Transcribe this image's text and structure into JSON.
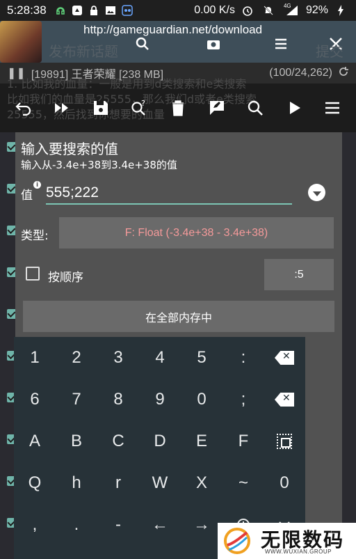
{
  "status_bar": {
    "time": "5:28:38",
    "network_speed": "0.00 K/s",
    "signal_label": "4G",
    "battery": "92%"
  },
  "browser": {
    "url": "http://gameguardian.net/download"
  },
  "background": {
    "title": "发布新话题",
    "submit": "提交",
    "process": "[19891] 王者荣耀 [238 MB]",
    "result_count": "(100/24,262)",
    "note_lines": [
      "1. 比如我的血量：一般是用到d类搜索和e类搜索",
      "比如我们的血量是25555，那么我们d或者e类搜索",
      "25555，然后找到你想要的血量"
    ]
  },
  "dialog": {
    "title": "输入要搜索的值",
    "subtitle": "输入从-3.4e+38到3.4e+38的值",
    "value_label": "值",
    "value": "555;222",
    "type_label": "类型:",
    "type_value": "F: Float (-3.4e+38 - 3.4e+38)",
    "order_label": "按顺序",
    "step_value": ":5",
    "region_label": "在全部内存中"
  },
  "keyboard": {
    "rows": [
      [
        "1",
        "2",
        "3",
        "4",
        "5",
        ":"
      ],
      [
        "6",
        "7",
        "8",
        "9",
        "0",
        ";"
      ],
      [
        "A",
        "B",
        "C",
        "D",
        "E",
        "F"
      ],
      [
        "Q",
        "h",
        "r",
        "W",
        "X",
        "~",
        "0"
      ],
      [
        ",",
        ".",
        "-",
        "←",
        "→"
      ]
    ]
  },
  "watermark": {
    "title": "无限数码",
    "url": "WWW.WUXIAN.GROUP"
  },
  "colors": {
    "accent": "#7cc6b4",
    "type_text": "#f59a9a",
    "dialog_bg": "#525252",
    "keyboard_bg": "#273238"
  }
}
